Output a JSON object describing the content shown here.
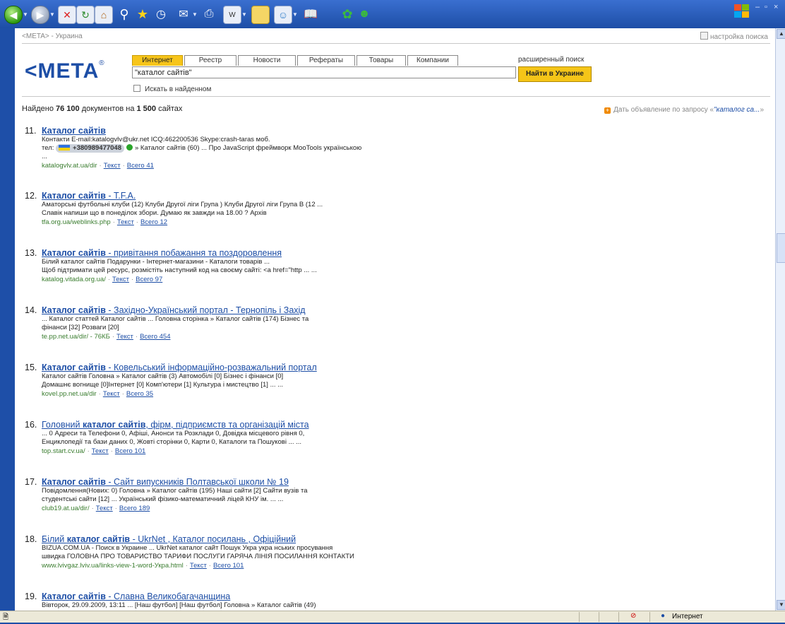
{
  "toolbar": {
    "icons": [
      "back-icon",
      "forward-icon",
      "stop-icon",
      "refresh-icon",
      "home-icon",
      "search-icon",
      "favorites-icon",
      "history-icon",
      "mail-icon",
      "print-icon",
      "edit-icon",
      "folder-icon",
      "messenger-icon",
      "research-icon",
      "flowers-icon",
      "people-icon"
    ]
  },
  "page": {
    "topline": "<META> - Украина",
    "settings": "настройка поиска",
    "logo": "<META",
    "logo_reg": "®",
    "tabs": [
      "Интернет",
      "Реестр",
      "Новости",
      "Рефераты",
      "Товары",
      "Компании"
    ],
    "query": "\"каталог сайтів\"",
    "search_button": "Найти в Украине",
    "advanced": "расширенный поиск",
    "in_found": "Искать в найденном",
    "found_prefix": "Найдено ",
    "found_docs": "76 100",
    "found_mid": " документов на ",
    "found_sites": "1 500",
    "found_suffix": " сайтах",
    "ad_prefix": "Дать объявление по запросу «",
    "ad_query": "\"каталог са...",
    "ad_suffix": "»"
  },
  "results": [
    {
      "num": "11.",
      "t1": "Каталог сайтів",
      "t2": "",
      "s1": "Контакти E-mail:katalogvlv@ukr.net ICQ:462200536 Skype:crash-taras моб.",
      "s2_pre": "тел:",
      "phone": "+380989477048",
      "s2_post": "» Каталог сайтів (60) ... Про JavaScript фреймворк MooTools українською",
      "s3": "...",
      "url": "katalogvlv.at.ua/dir",
      "size": "",
      "text": "Текст",
      "all": "Всего 41"
    },
    {
      "num": "12.",
      "t1": "Каталог сайтів",
      "t2": " - T.F.A.",
      "s1": "Аматорські футбольні клуби (12) Клуби Другої ліги Група ) Клуби Другої ліги Група В (12 ...",
      "s2": "Славік напиши що в понеділок збори. Думаю як завжди на 18.00 ? Архів",
      "url": "tfa.org.ua/weblinks.php",
      "size": "",
      "text": "Текст",
      "all": "Всего 12"
    },
    {
      "num": "13.",
      "t1": "Каталог сайтів",
      "t2": " - привітання побажання та поздоровлення",
      "s1": "Білий каталог сайтів Подарунки - Інтернет-магазини - Каталоги товарів ...",
      "s2": "Щоб підтримати цей ресурс, розмістіть наступний код на своєму сайті: <a href=\"http ... ...",
      "url": "katalog.vitada.org.ua/",
      "size": "",
      "text": "Текст",
      "all": "Всего 97"
    },
    {
      "num": "14.",
      "t1": "Каталог сайтів",
      "t2": " - Західно-Український портал - Тернопіль і Захід",
      "s1": "... Каталог статтей Каталог сайтів ... Головна сторінка » Каталог сайтів (174) Бізнес та",
      "s2": "фінанси [32] Розваги [20]",
      "url": "te.pp.net.ua/dir/",
      "size": " - 76КБ",
      "text": "Текст",
      "all": "Всего 454"
    },
    {
      "num": "15.",
      "t1": "Каталог сайтів",
      "t2": " - Ковельський інформаційно-розважальний портал",
      "s1": "Каталог сайтів Головна » Каталог сайтів (3) Автомобілі [0] Бізнес і фінанси [0]",
      "s2": "Домашнє вогнище [0]Інтернет [0] Комп'ютери [1] Культура і мистецтво [1] ... ...",
      "url": "kovel.pp.net.ua/dir",
      "size": "",
      "text": "Текст",
      "all": "Всего 35"
    },
    {
      "num": "16.",
      "t0": "Головний ",
      "t1": "каталог сайтів",
      "t2": ", фірм, підприємств та організацій міста",
      "s1": "... 0 Адреси та Телефони 0, Афіші, Анонси та Розклади 0, Довідка місцевого рівня 0,",
      "s2": "Енциклопедії та бази даних 0, Жовті сторінки 0, Карти 0, Каталоги та Пошукові ... ...",
      "url": "top.start.cv.ua/",
      "size": "",
      "text": "Текст",
      "all": "Всего 101"
    },
    {
      "num": "17.",
      "t1": "Каталог сайтів",
      "t2": " - Сайт випускників Полтавської школи № 19",
      "s1": "Повідомлення(Нових: 0) Головна » Каталог сайтів (195) Наші сайти [2] Сайти вузів та",
      "s2": "студентські сайти [12] ... Український фізико-математичний ліцей КНУ ім. ... ...",
      "url": "club19.at.ua/dir/",
      "size": "",
      "text": "Текст",
      "all": "Всего 189"
    },
    {
      "num": "18.",
      "t0": "Білий ",
      "t1": "каталог сайтів",
      "t2": " - UkrNet , Каталог посилань , Офіційний",
      "s1": "BIZUA.COM.UA - Поиск в Украине ... UkrNet каталог сайт Пошук Укра укра нських просування",
      "s2": "швидка ГОЛОВНА ПРО ТОВАРИСТВО ТАРИФИ ПОСЛУГИ ГАРЯЧА ЛІНІЯ ПОСИЛАННЯ КОНТАКТИ",
      "url": "www.lvivgaz.lviv.ua/links-view-1-word-Укра.html",
      "size": "",
      "text": "Текст",
      "all": "Всего 101"
    },
    {
      "num": "19.",
      "t1": "Каталог сайтів",
      "t2": " - Славна Великобагачанщина",
      "s1": "Вівторок, 29.09.2009, 13:11 ... [Наш футбол] [Наш футбол] Головна » Каталог сайтів (49)",
      "s2": "",
      "url": "",
      "size": "",
      "text": "",
      "all": ""
    }
  ],
  "status": {
    "zone": "Интернет"
  },
  "win": {
    "min": "–",
    "max": "▫",
    "close": "×"
  }
}
